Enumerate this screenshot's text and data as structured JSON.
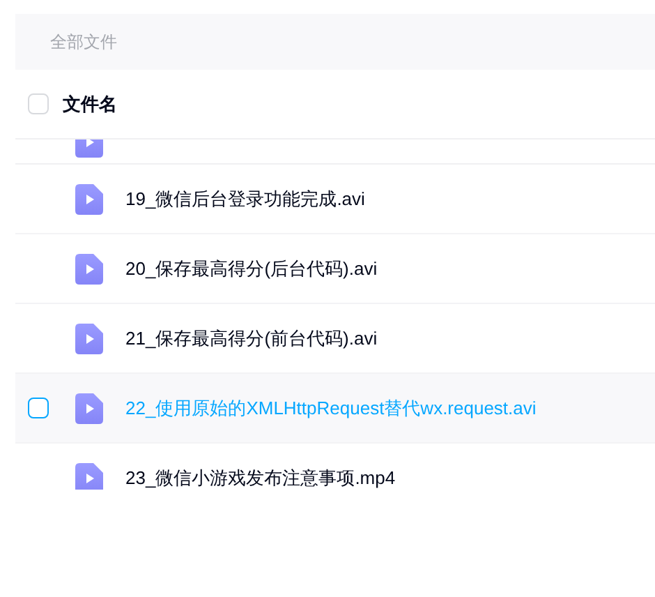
{
  "breadcrumb": "全部文件",
  "header": {
    "label": "文件名",
    "checked": false
  },
  "rows": [
    {
      "name": "19_微信后台登录功能完成.avi",
      "highlighted": false
    },
    {
      "name": "20_保存最高得分(后台代码).avi",
      "highlighted": false
    },
    {
      "name": "21_保存最高得分(前台代码).avi",
      "highlighted": false
    },
    {
      "name": "22_使用原始的XMLHttpRequest替代wx.request.avi",
      "highlighted": true
    },
    {
      "name": "23_微信小游戏发布注意事项.mp4",
      "highlighted": false
    }
  ]
}
